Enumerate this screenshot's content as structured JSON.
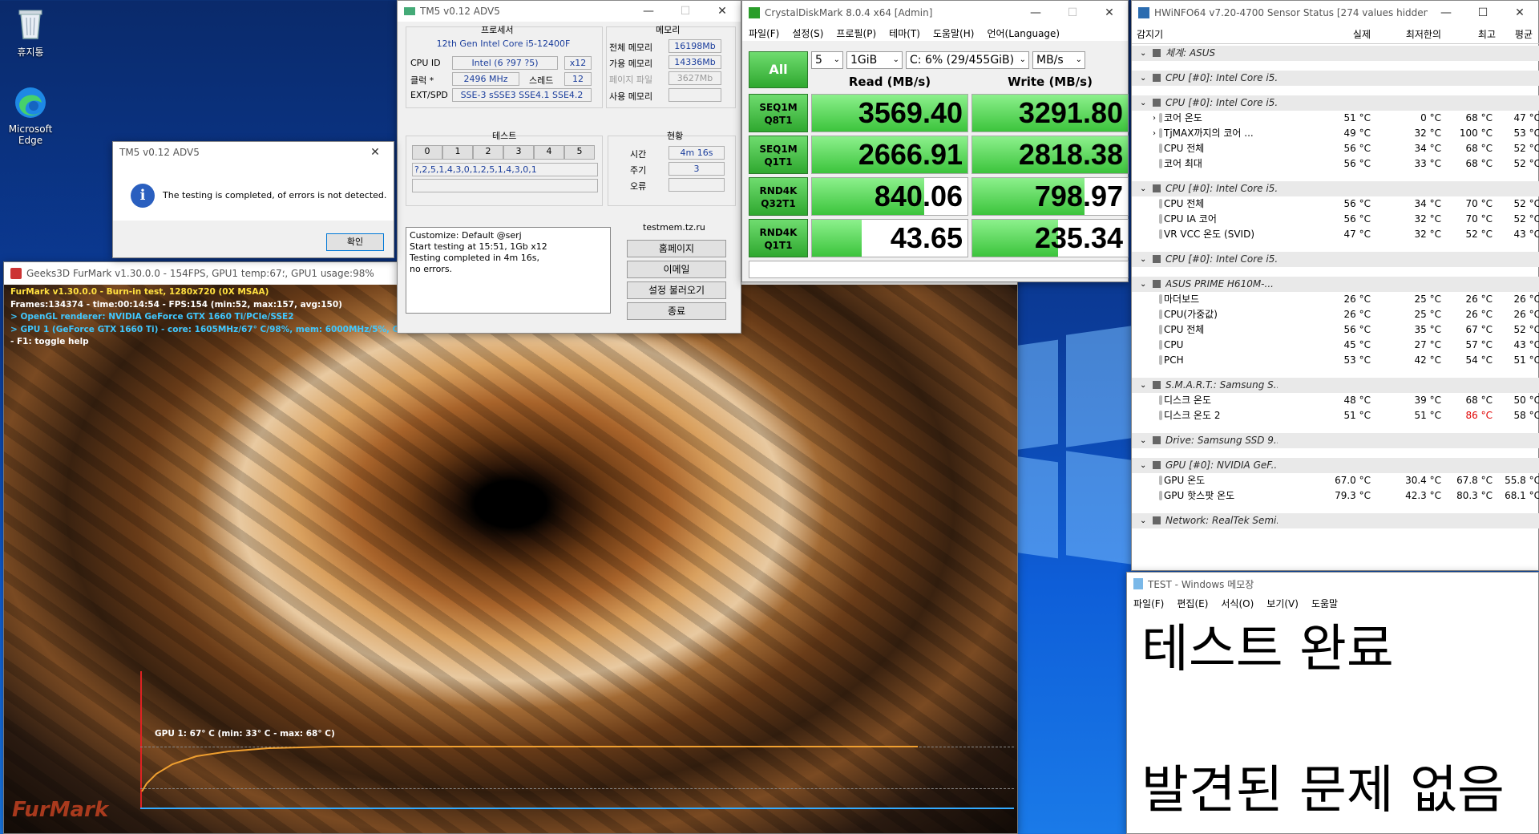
{
  "desktop": {
    "icons": [
      {
        "label": "휴지통",
        "icon": "recycle-bin-icon"
      },
      {
        "label": "Microsoft Edge",
        "icon": "edge-icon"
      }
    ]
  },
  "tm5": {
    "title": "TM5 v0.12 ADV5",
    "processor_header": "프로세서",
    "memory_header": "메모리",
    "cpu_name": "12th Gen Intel Core i5-12400F",
    "cpu_id_label": "CPU ID",
    "cpu_id_value": "Intel  (6 ?97 ?5)",
    "cpu_id_x": "x12",
    "clock_label": "클럭 *",
    "clock_value": "2496 MHz",
    "threads_label": "스레드",
    "threads_value": "12",
    "ext_label": "EXT/SPD",
    "ext_value": "SSE-3 sSSE3 SSE4.1 SSE4.2",
    "mem_total_label": "전체 메모리",
    "mem_total_value": "16198Mb",
    "mem_avail_label": "가용 메모리",
    "mem_avail_value": "14336Mb",
    "mem_page_label": "페이지 파일",
    "mem_page_value": "3627Mb",
    "mem_used_label": "사용 메모리",
    "mem_used_value": "",
    "test_header": "테스트",
    "test_cols": [
      "0",
      "1",
      "2",
      "3",
      "4",
      "5"
    ],
    "test_sequence": "?,2,5,1,4,3,0,1,2,5,1,4,3,0,1",
    "status_header": "현황",
    "time_label": "시간",
    "time_value": "4m 16s",
    "cycle_label": "주기",
    "cycle_value": "3",
    "error_label": "오류",
    "error_value": "",
    "log_lines": [
      "Customize: Default @serj",
      "Start testing at 15:51, 1Gb x12",
      "Testing completed in 4m 16s,",
      "no errors."
    ],
    "site": "testmem.tz.ru",
    "buttons": [
      "홈페이지",
      "이메일",
      "설정 불러오기",
      "종료"
    ]
  },
  "dialog": {
    "title": "TM5 v0.12 ADV5",
    "message": "The testing is completed, of errors is not detected.",
    "ok": "확인"
  },
  "furmark": {
    "title": "Geeks3D FurMark v1.30.0.0 - 154FPS, GPU1 temp:67؛, GPU1 usage:98%",
    "hud": [
      "FurMark v1.30.0.0 - Burn-in test, 1280x720 (0X MSAA)",
      "Frames:134374 - time:00:14:54 - FPS:154 (min:52, max:157, avg:150)",
      "> OpenGL renderer: NVIDIA GeForce GTX 1660 Ti/PCIe/SSE2",
      "> GPU 1 (GeForce GTX 1660 Ti) - core: 1605MHz/67° C/98%, mem: 6000MHz/5%, GPU power: 99.1% TDP, fan: 55%, limits:[power:1, temp:0, volt:0, OV:0]",
      "- F1: toggle help"
    ],
    "graph_label": "GPU 1: 67° C (min: 33° C - max: 68° C)",
    "logo_text": "FurMark"
  },
  "cdm": {
    "title": "CrystalDiskMark 8.0.4 x64 [Admin]",
    "menu": [
      "파일(F)",
      "설정(S)",
      "프로필(P)",
      "테마(T)",
      "도움말(H)",
      "언어(Language)"
    ],
    "all_btn": "All",
    "count": "5",
    "size": "1GiB",
    "drive": "C: 6% (29/455GiB)",
    "unit": "MB/s",
    "read_header": "Read (MB/s)",
    "write_header": "Write (MB/s)",
    "rows": [
      {
        "l1": "SEQ1M",
        "l2": "Q8T1",
        "read": "3569.40",
        "write": "3291.80",
        "rf": 1.0,
        "wf": 1.0
      },
      {
        "l1": "SEQ1M",
        "l2": "Q1T1",
        "read": "2666.91",
        "write": "2818.38",
        "rf": 1.0,
        "wf": 1.0
      },
      {
        "l1": "RND4K",
        "l2": "Q32T1",
        "read": "840.06",
        "write": "798.97",
        "rf": 0.72,
        "wf": 0.72
      },
      {
        "l1": "RND4K",
        "l2": "Q1T1",
        "read": "43.65",
        "write": "235.34",
        "rf": 0.32,
        "wf": 0.55
      }
    ]
  },
  "hwinfo": {
    "title": "HWiNFO64 v7.20-4700 Sensor Status [274 values hidden]",
    "cols": [
      "감지기",
      "실제",
      "최저한의",
      "최고",
      "평균"
    ],
    "rows": [
      {
        "t": "sec",
        "n": "체계: ASUS"
      },
      {
        "t": "gap"
      },
      {
        "t": "sec",
        "n": "CPU [#0]: Intel Core i5..."
      },
      {
        "t": "gap"
      },
      {
        "t": "sec",
        "n": "CPU [#0]: Intel Core i5..."
      },
      {
        "t": "item",
        "n": "코어 온도",
        "a": "51 °C",
        "b": "0 °C",
        "c": "68 °C",
        "d": "47 °C",
        "exp": true
      },
      {
        "t": "item",
        "n": "TjMAX까지의 코어 ...",
        "a": "49 °C",
        "b": "32 °C",
        "c": "100 °C",
        "d": "53 °C",
        "exp": true
      },
      {
        "t": "item",
        "n": "CPU 전체",
        "a": "56 °C",
        "b": "34 °C",
        "c": "68 °C",
        "d": "52 °C"
      },
      {
        "t": "item",
        "n": "코어 최대",
        "a": "56 °C",
        "b": "33 °C",
        "c": "68 °C",
        "d": "52 °C"
      },
      {
        "t": "gap"
      },
      {
        "t": "sec",
        "n": "CPU [#0]: Intel Core i5..."
      },
      {
        "t": "item",
        "n": "CPU 전체",
        "a": "56 °C",
        "b": "34 °C",
        "c": "70 °C",
        "d": "52 °C"
      },
      {
        "t": "item",
        "n": "CPU IA 코어",
        "a": "56 °C",
        "b": "32 °C",
        "c": "70 °C",
        "d": "52 °C"
      },
      {
        "t": "item",
        "n": "VR VCC 온도 (SVID)",
        "a": "47 °C",
        "b": "32 °C",
        "c": "52 °C",
        "d": "43 °C"
      },
      {
        "t": "gap"
      },
      {
        "t": "sec",
        "n": "CPU [#0]: Intel Core i5..."
      },
      {
        "t": "gap"
      },
      {
        "t": "sec",
        "n": "ASUS PRIME H610M-..."
      },
      {
        "t": "item",
        "n": "마더보드",
        "a": "26 °C",
        "b": "25 °C",
        "c": "26 °C",
        "d": "26 °C"
      },
      {
        "t": "item",
        "n": "CPU(가중값)",
        "a": "26 °C",
        "b": "25 °C",
        "c": "26 °C",
        "d": "26 °C"
      },
      {
        "t": "item",
        "n": "CPU 전체",
        "a": "56 °C",
        "b": "35 °C",
        "c": "67 °C",
        "d": "52 °C"
      },
      {
        "t": "item",
        "n": "CPU",
        "a": "45 °C",
        "b": "27 °C",
        "c": "57 °C",
        "d": "43 °C"
      },
      {
        "t": "item",
        "n": "PCH",
        "a": "53 °C",
        "b": "42 °C",
        "c": "54 °C",
        "d": "51 °C"
      },
      {
        "t": "gap"
      },
      {
        "t": "sec",
        "n": "S.M.A.R.T.: Samsung S..."
      },
      {
        "t": "item",
        "n": "디스크 온도",
        "a": "48 °C",
        "b": "39 °C",
        "c": "68 °C",
        "d": "50 °C"
      },
      {
        "t": "item",
        "n": "디스크 온도 2",
        "a": "51 °C",
        "b": "51 °C",
        "c": "86 °C",
        "d": "58 °C",
        "red": true
      },
      {
        "t": "gap"
      },
      {
        "t": "sec",
        "n": "Drive: Samsung SSD 9..."
      },
      {
        "t": "gap"
      },
      {
        "t": "sec",
        "n": "GPU [#0]: NVIDIA GeF..."
      },
      {
        "t": "item",
        "n": "GPU 온도",
        "a": "67.0 °C",
        "b": "30.4 °C",
        "c": "67.8 °C",
        "d": "55.8 °C"
      },
      {
        "t": "item",
        "n": "GPU 핫스팟 온도",
        "a": "79.3 °C",
        "b": "42.3 °C",
        "c": "80.3 °C",
        "d": "68.1 °C"
      },
      {
        "t": "gap"
      },
      {
        "t": "sec",
        "n": "Network: RealTek Semi..."
      }
    ]
  },
  "notepad": {
    "title": "TEST - Windows 메모장",
    "menu": [
      "파일(F)",
      "편집(E)",
      "서식(O)",
      "보기(V)",
      "도움말"
    ],
    "line1": "테스트 완료",
    "line2": "발견된 문제 없음"
  },
  "colors": {
    "accent_green": "#3cc43c",
    "furmark_hud_yellow": "#ffe040",
    "furmark_hud_cyan": "#40c8ff",
    "hw_red": "#e00000"
  }
}
